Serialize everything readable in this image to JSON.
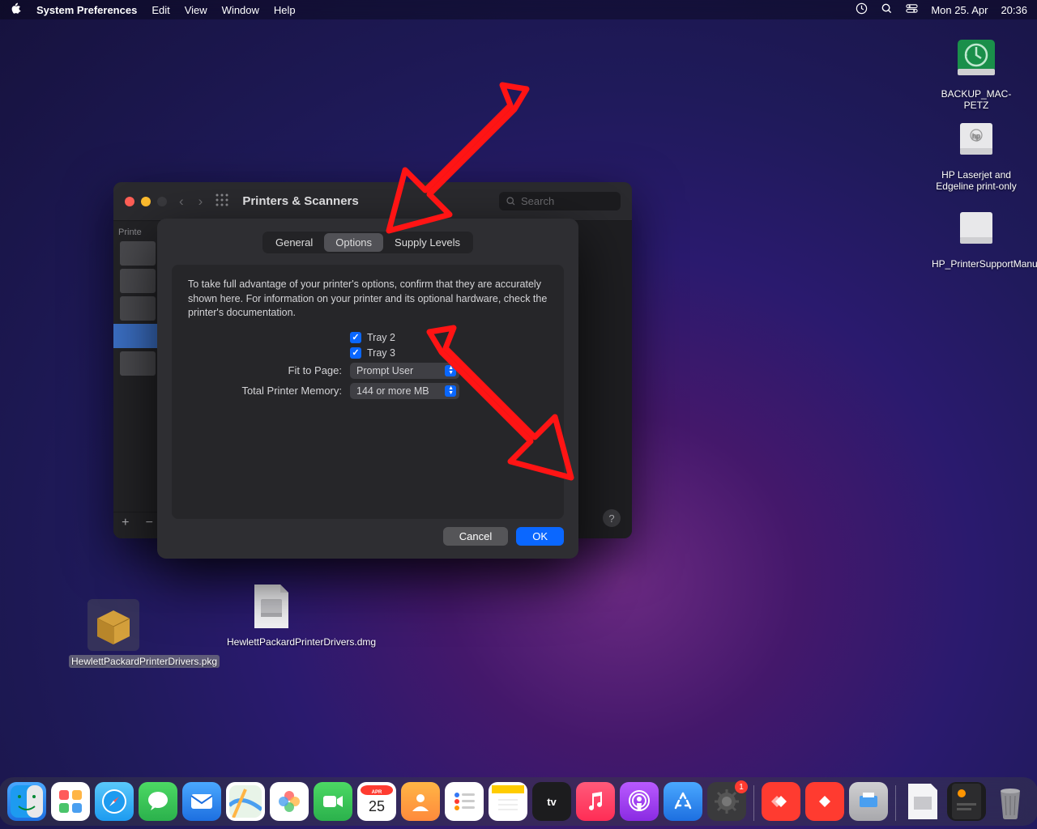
{
  "menubar": {
    "app": "System Preferences",
    "items": [
      "Edit",
      "View",
      "Window",
      "Help"
    ],
    "date": "Mon 25. Apr",
    "time": "20:36"
  },
  "desktop": {
    "backup": "BACKUP_MAC-PETZ",
    "hp_drive": "HP Laserjet and Edgeline print-only",
    "hp_manual": "HP_PrinterSupportManual",
    "pkg": "HewlettPackardPrinterDrivers.pkg",
    "dmg": "HewlettPackardPrinterDrivers.dmg"
  },
  "prefwin": {
    "title": "Printers & Scanners",
    "search_placeholder": "Search",
    "sidebar_header": "Printe"
  },
  "sheet": {
    "tabs": {
      "general": "General",
      "options": "Options",
      "supply": "Supply Levels"
    },
    "desc": "To take full advantage of your printer's options, confirm that they are accurately shown here. For information on your printer and its optional hardware, check the printer's documentation.",
    "tray2": "Tray 2",
    "tray3": "Tray 3",
    "fit_label": "Fit to Page:",
    "fit_value": "Prompt User",
    "mem_label": "Total Printer Memory:",
    "mem_value": "144 or more MB",
    "cancel": "Cancel",
    "ok": "OK"
  }
}
